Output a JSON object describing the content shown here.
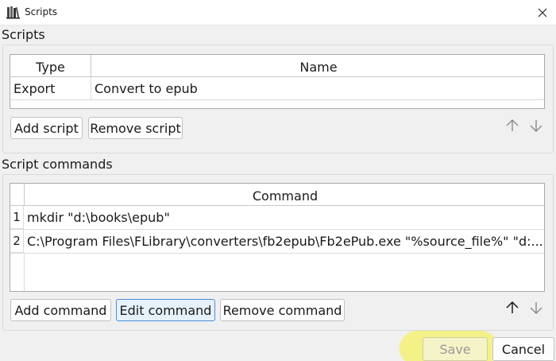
{
  "window": {
    "title": "Scripts",
    "icon": "books-icon",
    "close_icon": "close-icon"
  },
  "scripts_section": {
    "label": "Scripts",
    "columns": [
      "Type",
      "Name"
    ],
    "rows": [
      {
        "type": "Export",
        "name": "Convert to epub"
      }
    ],
    "add_label": "Add script",
    "remove_label": "Remove script",
    "up_icon": "arrow-up-icon",
    "down_icon": "arrow-down-icon"
  },
  "commands_section": {
    "label": "Script commands",
    "column": "Command",
    "rows": [
      {
        "num": "1",
        "command": "mkdir \"d:\\books\\epub\""
      },
      {
        "num": "2",
        "command": "C:\\Program Files\\FLibrary\\converters\\fb2epub\\Fb2ePub.exe \"%source_file%\" \"d:..."
      }
    ],
    "add_label": "Add command",
    "edit_label": "Edit command",
    "remove_label": "Remove command",
    "up_icon": "arrow-up-icon",
    "down_icon": "arrow-down-icon"
  },
  "footer": {
    "save_label": "Save",
    "cancel_label": "Cancel"
  },
  "colors": {
    "highlight": "#f4f186",
    "focus_border": "#4a90d9",
    "disabled_text": "#9a9a9a",
    "arrow_disabled": "#8a8a8a"
  }
}
